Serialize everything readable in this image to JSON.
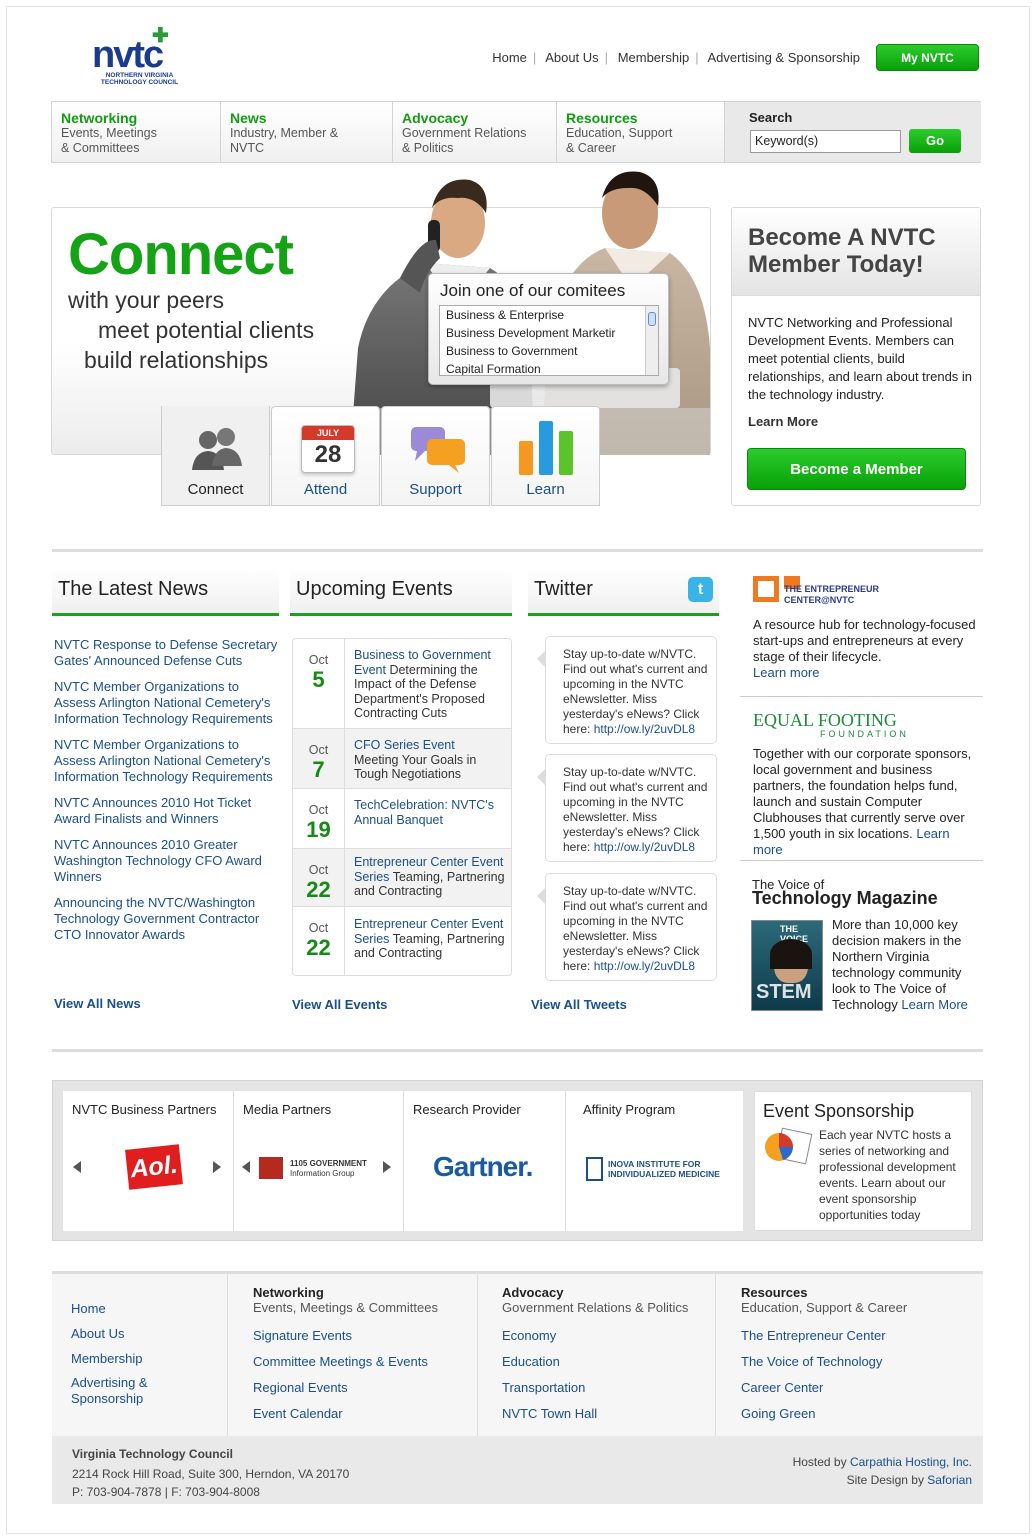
{
  "logo": {
    "word": "nvtc",
    "subtitle_line1": "NORTHERN VIRGINIA",
    "subtitle_line2": "TECHNOLOGY COUNCIL"
  },
  "topnav": [
    "Home",
    "About Us",
    "Membership",
    "Advertising & Sponsorship"
  ],
  "my_nvtc": "My NVTC",
  "mainnav": [
    {
      "title": "Networking",
      "sub1": "Events, Meetings",
      "sub2": "& Committees"
    },
    {
      "title": "News",
      "sub1": "Industry, Member &",
      "sub2": "NVTC"
    },
    {
      "title": "Advocacy",
      "sub1": "Government Relations",
      "sub2": "& Politics"
    },
    {
      "title": "Resources",
      "sub1": "Education, Support",
      "sub2": "& Career"
    }
  ],
  "search": {
    "label": "Search",
    "value": "Keyword(s)",
    "button": "Go"
  },
  "hero": {
    "headline": "Connect",
    "line1": "with your peers",
    "line2": "meet potential clients",
    "line3": "build relationships",
    "comitees_title": "Join one of our comitees",
    "comitees": [
      "Business & Enterprise",
      "Business Development Marketir",
      "Business to Government",
      "Capital Formation"
    ],
    "tabs": [
      "Connect",
      "Attend",
      "Support",
      "Learn"
    ],
    "calendar_month": "JULY",
    "calendar_day": "28"
  },
  "member": {
    "title": "Become A NVTC Member Today!",
    "desc": "NVTC Networking and Professional Development Events. Members can meet potential clients, build relationships, and learn about trends in the technology industry.",
    "learn": "Learn More",
    "button": "Become a Member"
  },
  "sections": {
    "news": "The Latest News",
    "events": "Upcoming Events",
    "twitter": "Twitter"
  },
  "news": [
    "NVTC Response to Defense Secretary Gates' Announced Defense Cuts",
    "NVTC Member Organizations to Assess Arlington National Cemetery's Information Technology Requirements",
    "NVTC Member Organizations to Assess Arlington National Cemetery's Information Technology Requirements",
    "NVTC Announces 2010 Hot Ticket Award Finalists and Winners",
    "NVTC Announces 2010 Greater Washington Technology CFO Award Winners",
    "Announcing the NVTC/Washington Technology Government Contractor CTO Innovator Awards"
  ],
  "view_all_news": "View All News",
  "events": [
    {
      "month": "Oct",
      "day": "5",
      "title": "Business to Government Event",
      "desc": "Determining the Impact of the Defense Department's Proposed Contracting Cuts"
    },
    {
      "month": "Oct",
      "day": "7",
      "title": "CFO Series Event",
      "desc": "Meeting Your Goals in Tough Negotiations"
    },
    {
      "month": "Oct",
      "day": "19",
      "title": "TechCelebration: NVTC's Annual Banquet",
      "desc": ""
    },
    {
      "month": "Oct",
      "day": "22",
      "title": "Entrepreneur Center Event Series",
      "desc": "Teaming, Partnering and Contracting"
    },
    {
      "month": "Oct",
      "day": "22",
      "title": "Entrepreneur Center Event Series",
      "desc": "Teaming, Partnering and Contracting"
    }
  ],
  "view_all_events": "View All Events",
  "tweets": [
    {
      "text": "Stay up-to-date w/NVTC. Find out what's current and upcoming in the NVTC eNewsletter. Miss yesterday's eNews? Click here:",
      "link": "http://ow.ly/2uvDL8"
    },
    {
      "text": "Stay up-to-date w/NVTC. Find out what's current and upcoming in the NVTC eNewsletter. Miss yesterday's eNews? Click here:",
      "link": "http://ow.ly/2uvDL8"
    },
    {
      "text": "Stay up-to-date w/NVTC. Find out what's current and upcoming in the NVTC eNewsletter. Miss yesterday's eNews? Click here:",
      "link": "http://ow.ly/2uvDL8"
    }
  ],
  "view_all_tweets": "View All Tweets",
  "side": {
    "ec_logo_line1": "THE ENTREPRENEUR",
    "ec_logo_line2": "CENTER@NVTC",
    "ec_text": "A resource hub for technology-focused start-ups and entrepreneurs at every stage of their lifecycle.",
    "ec_link": "Learn more",
    "ef_logo_line1": "EQUAL FOOTING",
    "ef_logo_line2": "FOUNDATION",
    "ef_text": "Together with our corporate sponsors, local government and business partners, the foundation helps fund, launch and sustain Computer Clubhouses that currently serve over 1,500 youth in six locations.",
    "ef_link": "Learn more",
    "mag_pre": "The Voice of",
    "mag_title": "Technology Magazine",
    "mag_text": "More than 10,000 key decision makers in the Northern Virginia technology community look to The Voice of Technology",
    "mag_link": "Learn More",
    "mag_cover_top": "THE VOICE",
    "mag_cover_word": "STEM"
  },
  "partners": [
    {
      "heading": "NVTC Business Partners",
      "logo": "Aol."
    },
    {
      "heading": "Media Partners",
      "logo_line1": "1105 GOVERNMENT",
      "logo_line2": "Information Group"
    },
    {
      "heading": "Research Provider",
      "logo": "Gartner."
    },
    {
      "heading": "Affinity Program",
      "logo_line1": "INOVA INSTITUTE FOR",
      "logo_line2": "INDIVIDUALIZED MEDICINE"
    }
  ],
  "sponsorship": {
    "title": "Event Sponsorship",
    "text": "Each year NVTC hosts a series of networking and professional development events. Learn  about our event sponsorship opportunities today"
  },
  "footer": {
    "col1": [
      "Home",
      "About Us",
      "Membership",
      "Advertising & Sponsorship"
    ],
    "col2": {
      "title": "Networking",
      "sub": "Events, Meetings & Committees",
      "links": [
        "Signature Events",
        "Committee Meetings & Events",
        "Regional Events",
        "Event Calendar"
      ]
    },
    "col3": {
      "title": "Advocacy",
      "sub": "Government Relations & Politics",
      "links": [
        "Economy",
        "Education",
        "Transportation",
        "NVTC Town Hall"
      ]
    },
    "col4": {
      "title": "Resources",
      "sub": "Education, Support & Career",
      "links": [
        "The Entrepreneur Center",
        "The Voice of Technology",
        "Career Center",
        "Going Green"
      ]
    },
    "org": "Virginia Technology Council",
    "address": "2214 Rock Hill Road, Suite 300, Herndon, VA 20170",
    "phone": "P: 703-904-7878 | F: 703-904-8008",
    "hosted_pre": "Hosted by",
    "hosted": "Carpathia Hosting, Inc.",
    "design_pre": "Site Design by",
    "design": "Saforian"
  }
}
